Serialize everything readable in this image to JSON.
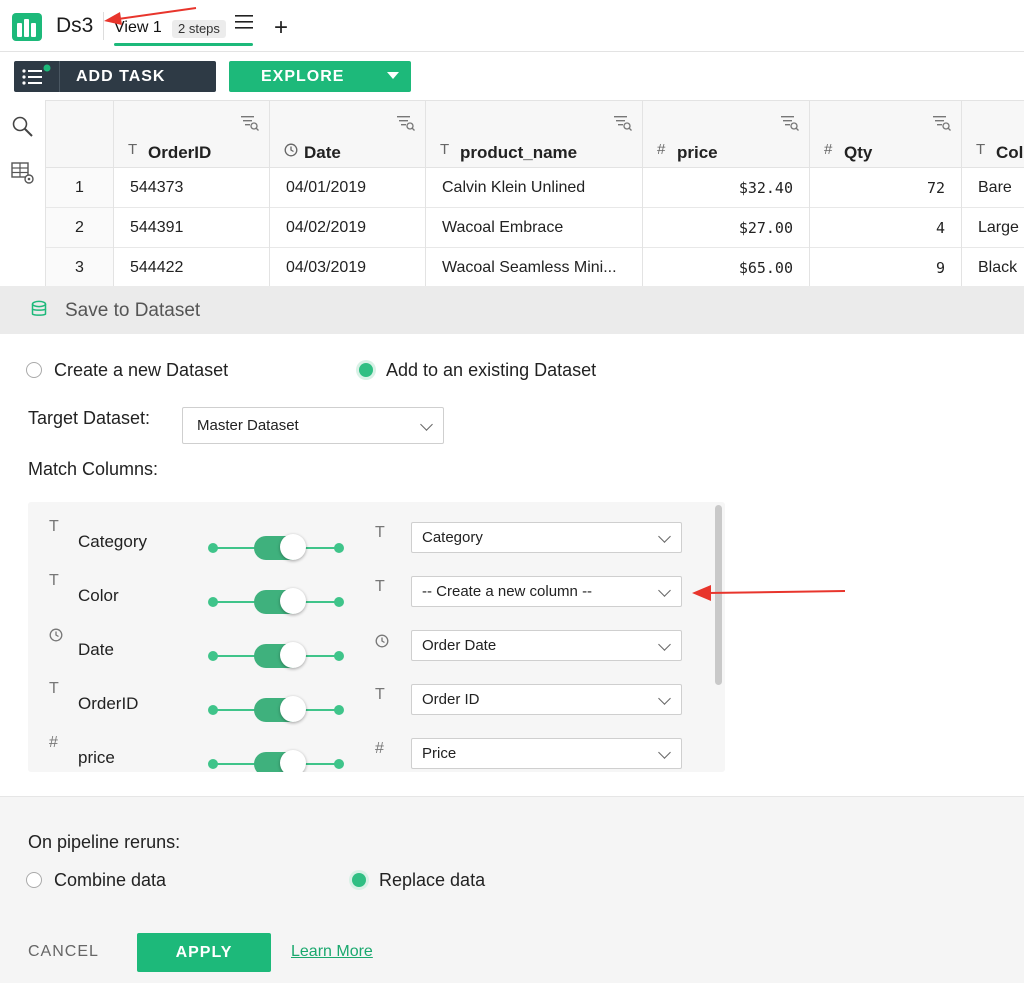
{
  "header": {
    "title": "Ds3",
    "view_tab": "View 1",
    "steps_badge": "2 steps"
  },
  "toolbar": {
    "add_task_label": "ADD TASK",
    "explore_label": "EXPLORE"
  },
  "table": {
    "columns": [
      {
        "type": "T",
        "name": "OrderID"
      },
      {
        "type": "clock",
        "name": "Date"
      },
      {
        "type": "T",
        "name": "product_name"
      },
      {
        "type": "#",
        "name": "price"
      },
      {
        "type": "#",
        "name": "Qty"
      },
      {
        "type": "T",
        "name": "Colo"
      }
    ],
    "rows": [
      {
        "idx": "1",
        "cells": [
          "544373",
          "04/01/2019",
          "Calvin Klein Unlined",
          "$32.40",
          "72",
          "Bare"
        ]
      },
      {
        "idx": "2",
        "cells": [
          "544391",
          "04/02/2019",
          "Wacoal Embrace",
          "$27.00",
          "4",
          "Large"
        ]
      },
      {
        "idx": "3",
        "cells": [
          "544422",
          "04/03/2019",
          "Wacoal Seamless Mini...",
          "$65.00",
          "9",
          "Black"
        ]
      }
    ]
  },
  "panel": {
    "title": "Save to Dataset",
    "mode_options": [
      "Create a new Dataset",
      "Add to an existing Dataset"
    ],
    "mode_selected": 1,
    "target_label": "Target Dataset:",
    "target_value": "Master Dataset",
    "match_label": "Match Columns:",
    "matches": [
      {
        "src_type": "T",
        "source": "Category",
        "dst_type": "T",
        "target": "Category"
      },
      {
        "src_type": "T",
        "source": "Color",
        "dst_type": "T",
        "target": "-- Create a new column --"
      },
      {
        "src_type": "clock",
        "source": "Date",
        "dst_type": "clock",
        "target": "Order Date"
      },
      {
        "src_type": "T",
        "source": "OrderID",
        "dst_type": "T",
        "target": "Order ID"
      },
      {
        "src_type": "#",
        "source": "price",
        "dst_type": "#",
        "target": "Price"
      }
    ],
    "rerun_label": "On pipeline reruns:",
    "rerun_options": [
      "Combine data",
      "Replace data"
    ],
    "rerun_selected": 1
  },
  "footer": {
    "cancel_label": "CANCEL",
    "apply_label": "APPLY",
    "learn_more": "Learn More"
  },
  "colors": {
    "accent": "#1db97a",
    "dark_button": "#2e3a45",
    "annotation_arrow": "#e8352c"
  }
}
